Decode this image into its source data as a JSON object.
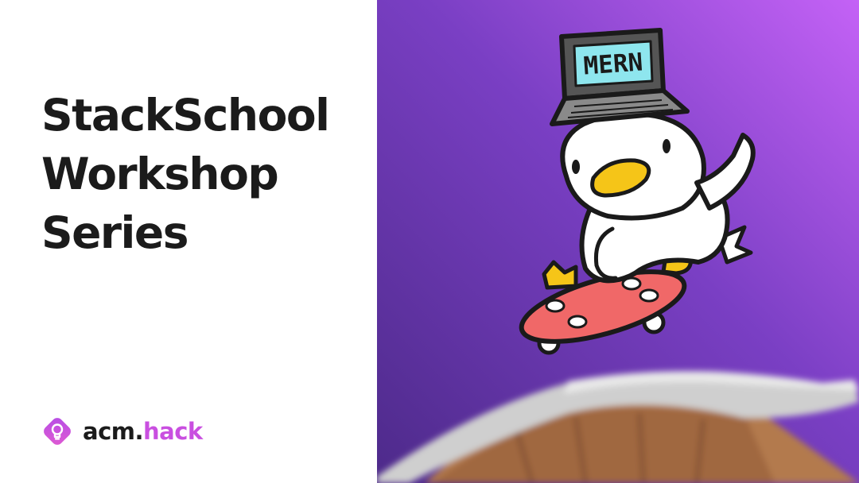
{
  "title": {
    "line1": "StackSchool",
    "line2": "Workshop",
    "line3": "Series"
  },
  "brand": {
    "name_part1": "acm.",
    "name_part2": "hack",
    "logo_icon": "lightbulb-icon",
    "accent_color": "#c94fe0"
  },
  "illustration": {
    "laptop_screen_text": "MERN",
    "background_gradient": [
      "#5a2d9e",
      "#c060f5"
    ],
    "board_color": "#f06868",
    "beak_color": "#f5c518",
    "laptop_screen_color": "#8ee6ee"
  }
}
